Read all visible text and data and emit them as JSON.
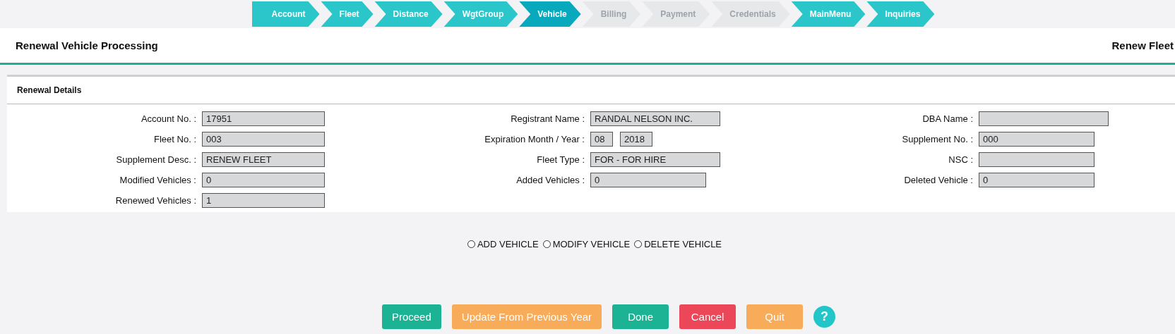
{
  "steps": [
    {
      "label": "Account",
      "selected": false,
      "disabled": false
    },
    {
      "label": "Fleet",
      "selected": false,
      "disabled": false
    },
    {
      "label": "Distance",
      "selected": false,
      "disabled": false
    },
    {
      "label": "WgtGroup",
      "selected": false,
      "disabled": false
    },
    {
      "label": "Vehicle",
      "selected": true,
      "disabled": false
    },
    {
      "label": "Billing",
      "selected": false,
      "disabled": true
    },
    {
      "label": "Payment",
      "selected": false,
      "disabled": true
    },
    {
      "label": "Credentials",
      "selected": false,
      "disabled": true
    },
    {
      "label": "MainMenu",
      "selected": false,
      "disabled": false
    },
    {
      "label": "Inquiries",
      "selected": false,
      "disabled": false
    }
  ],
  "header": {
    "title": "Renewal Vehicle Processing",
    "right": "Renew Fleet"
  },
  "panel": {
    "title": "Renewal Details",
    "columns": [
      [
        {
          "label": "Account No. :",
          "values": [
            "17951"
          ]
        },
        {
          "label": "Fleet No. :",
          "values": [
            "003"
          ]
        },
        {
          "label": "Supplement Desc. :",
          "values": [
            "RENEW FLEET"
          ]
        },
        {
          "label": "Modified Vehicles :",
          "values": [
            "0"
          ]
        },
        {
          "label": "Renewed Vehicles :",
          "values": [
            "1"
          ]
        }
      ],
      [
        {
          "label": "Registrant Name :",
          "values": [
            "RANDAL NELSON INC."
          ]
        },
        {
          "label": "Expiration Month / Year :",
          "values": [
            "08",
            "2018"
          ]
        },
        {
          "label": "Fleet Type :",
          "values": [
            "FOR - FOR HIRE"
          ]
        },
        {
          "label": "Added Vehicles :",
          "values": [
            "0"
          ]
        }
      ],
      [
        {
          "label": "DBA Name :"
        },
        {
          "label": "Supplement No. :",
          "values": [
            "000"
          ]
        },
        {
          "label": "NSC :"
        },
        {
          "label": "Deleted Vehicle :",
          "values": [
            "0"
          ]
        }
      ]
    ]
  },
  "options": [
    {
      "label": "ADD VEHICLE",
      "selected": false
    },
    {
      "label": "MODIFY VEHICLE",
      "selected": false
    },
    {
      "label": "DELETE VEHICLE",
      "selected": false
    }
  ],
  "buttons": [
    {
      "label": "Proceed",
      "kind": "primary"
    },
    {
      "label": "Update From Previous Year",
      "kind": "warning"
    },
    {
      "label": "Done",
      "kind": "primary"
    },
    {
      "label": "Cancel",
      "kind": "danger"
    },
    {
      "label": "Quit",
      "kind": "warning"
    },
    {
      "label": "?",
      "kind": "help"
    }
  ]
}
